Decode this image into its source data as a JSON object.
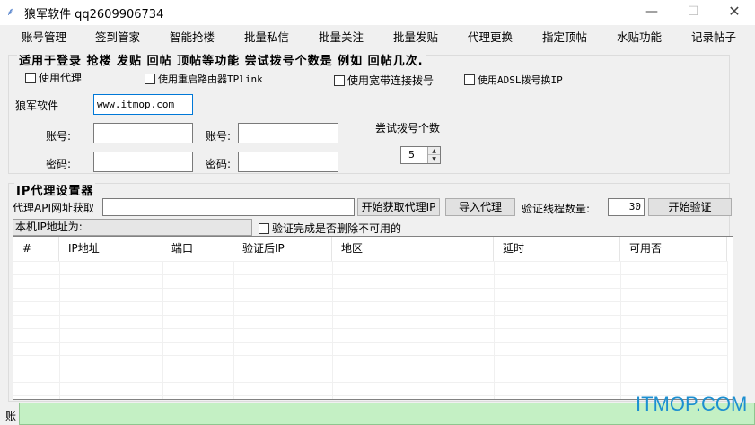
{
  "window": {
    "title": "狼军软件  qq2609906734",
    "icon": "wolf-feather-icon",
    "minimize": "—",
    "maximize": "☐",
    "close": "✕"
  },
  "tabs": [
    "账号管理",
    "签到管家",
    "智能抢楼",
    "批量私信",
    "批量关注",
    "批量发贴",
    "代理更换",
    "指定顶帖",
    "水贴功能",
    "记录帖子"
  ],
  "dial_panel": {
    "title": "适用于登录 抢楼 发贴 回帖 顶帖等功能 尝试拨号个数是 例如 回帖几次.",
    "use_proxy": "使用代理",
    "use_router_restart": "使用重启路由器TPlink",
    "use_broadband": "使用宽带连接拨号",
    "use_adsl": "使用ADSL拨号换IP",
    "software_label": "狼军软件",
    "software_value": "www.itmop.com",
    "account_label_1": "账号:",
    "account_label_2": "账号:",
    "password_label_1": "密码:",
    "password_label_2": "密码:",
    "try_count_label": "尝试拨号个数",
    "try_count_value": "5"
  },
  "ip_panel": {
    "title": "IP代理设置器",
    "api_label": "代理API网址获取",
    "api_value": "",
    "fetch_button": "开始获取代理IP",
    "import_button": "导入代理",
    "threads_label": "验证线程数量:",
    "threads_value": "30",
    "verify_button": "开始验证",
    "local_ip_label": "本机IP地址为:",
    "delete_unavailable": "验证完成是否删除不可用的"
  },
  "table": {
    "columns": [
      "#",
      "IP地址",
      "端口",
      "验证后IP",
      "地区",
      "延时",
      "可用否"
    ],
    "rows": []
  },
  "status": {
    "label": "账",
    "progress": 0
  },
  "watermark": "ITMOP.COM"
}
